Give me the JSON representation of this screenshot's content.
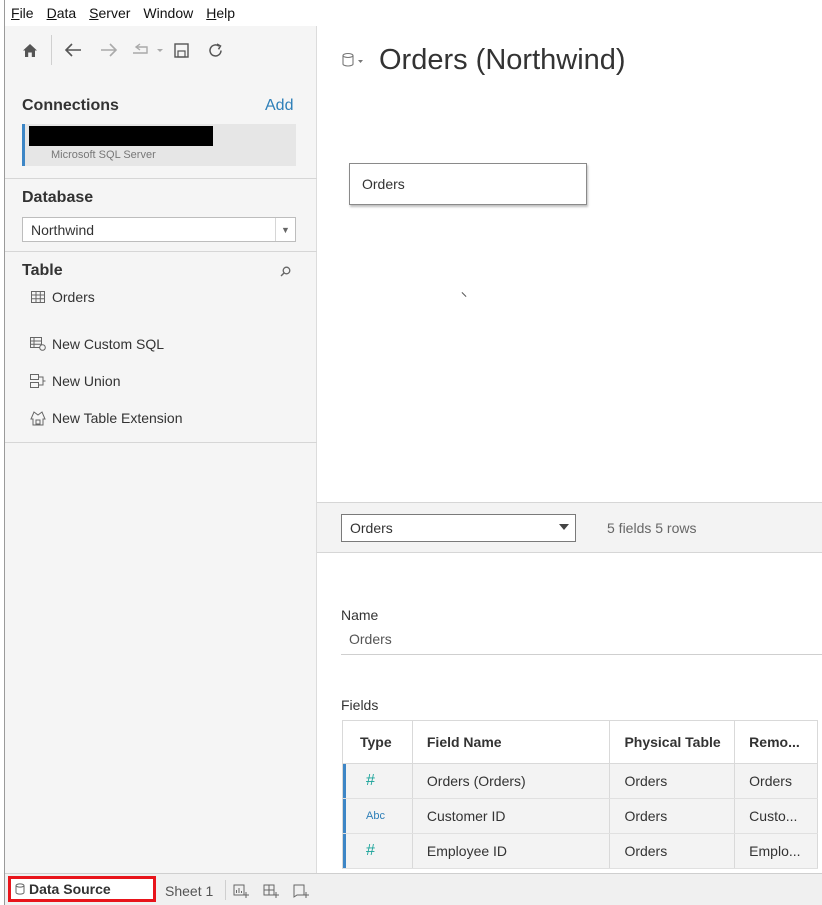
{
  "menu": [
    {
      "key": "F",
      "rest": "ile"
    },
    {
      "key": "D",
      "rest": "ata"
    },
    {
      "key": "S",
      "rest": "erver"
    },
    {
      "key": "Win",
      "rest": "dow",
      "underline_index": 3
    },
    {
      "key": "H",
      "rest": "elp"
    }
  ],
  "toolbar": {
    "icons": [
      "home-icon",
      "back-icon",
      "forward-icon",
      "redo-icon",
      "save-icon",
      "refresh-icon"
    ]
  },
  "connections": {
    "title": "Connections",
    "add_label": "Add",
    "items": [
      {
        "type": "Microsoft SQL Server"
      }
    ]
  },
  "database": {
    "title": "Database",
    "selected": "Northwind"
  },
  "table_section": {
    "title": "Table",
    "tables": [
      {
        "name": "Orders",
        "icon": "table-icon"
      }
    ],
    "actions": [
      {
        "label": "New Custom SQL",
        "icon": "custom-sql-icon"
      },
      {
        "label": "New Union",
        "icon": "union-icon"
      },
      {
        "label": "New Table Extension",
        "icon": "table-extension-icon"
      }
    ]
  },
  "canvas": {
    "title": "Orders (Northwind)",
    "table_box": "Orders"
  },
  "preview": {
    "selected_table": "Orders",
    "count_text": "5 fields 5 rows"
  },
  "metadata": {
    "name_label": "Name",
    "name_value": "Orders",
    "fields_label": "Fields",
    "columns": [
      "Type",
      "Field Name",
      "Physical Table",
      "Remo..."
    ],
    "rows": [
      {
        "type": "#",
        "type_kind": "number",
        "field": "Orders (Orders)",
        "physical": "Orders",
        "remote": "Orders"
      },
      {
        "type": "Abc",
        "type_kind": "string",
        "field": "Customer ID",
        "physical": "Orders",
        "remote": "Custo..."
      },
      {
        "type": "#",
        "type_kind": "number",
        "field": "Employee ID",
        "physical": "Orders",
        "remote": "Emplo..."
      }
    ]
  },
  "tabs": {
    "data_source": "Data Source",
    "sheet": "Sheet 1",
    "icons": [
      "new-worksheet-icon",
      "new-dashboard-icon",
      "new-story-icon"
    ]
  },
  "colors": {
    "accent_blue": "#3d86c6",
    "highlight_red": "#e8141b",
    "number_type": "#1aa39a"
  }
}
